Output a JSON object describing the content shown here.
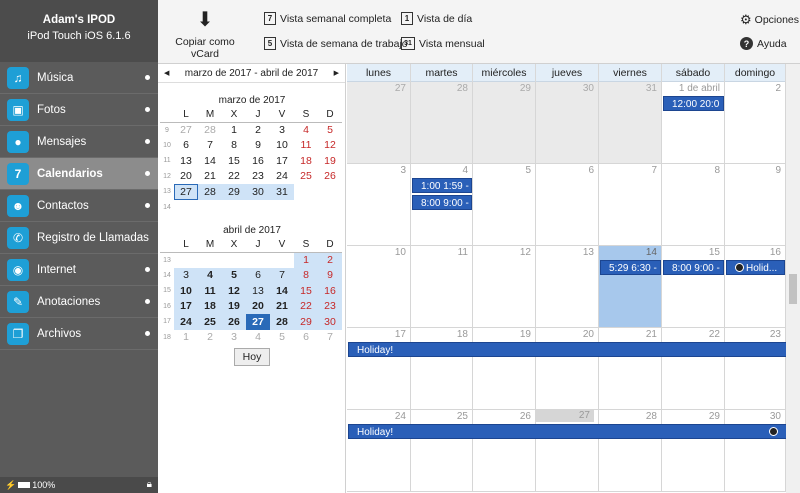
{
  "device": {
    "name": "Adam's IPOD",
    "model": "iPod Touch iOS 6.1.6"
  },
  "sidebar": {
    "items": [
      {
        "label": "Música",
        "icon": "music-icon"
      },
      {
        "label": "Fotos",
        "icon": "photos-icon"
      },
      {
        "label": "Mensajes",
        "icon": "messages-icon"
      },
      {
        "label": "Calendarios",
        "icon": "calendar-icon"
      },
      {
        "label": "Contactos",
        "icon": "contacts-icon"
      },
      {
        "label": "Registro de Llamadas",
        "icon": "phone-icon"
      },
      {
        "label": "Internet",
        "icon": "internet-icon"
      },
      {
        "label": "Anotaciones",
        "icon": "notes-icon"
      },
      {
        "label": "Archivos",
        "icon": "files-icon"
      }
    ],
    "battery": "100%"
  },
  "toolbar": {
    "vcard": "Copiar como vCard",
    "week_full": "Vista semanal completa",
    "work_week": "Vista de semana de trabajo",
    "day": "Vista de día",
    "month": "Vista mensual",
    "options": "Opciones",
    "help": "Ayuda"
  },
  "mini": {
    "range": "marzo de 2017 - abril de 2017",
    "prev": "◀",
    "next": "▶",
    "headers": [
      "L",
      "M",
      "X",
      "J",
      "V",
      "S",
      "D"
    ],
    "m1": {
      "title": "marzo de 2017",
      "weeks": [
        [
          "9",
          [
            "27",
            "28",
            "1",
            "2",
            "3",
            "4",
            "5"
          ]
        ],
        [
          "10",
          [
            "6",
            "7",
            "8",
            "9",
            "10",
            "11",
            "12"
          ]
        ],
        [
          "11",
          [
            "13",
            "14",
            "15",
            "16",
            "17",
            "18",
            "19"
          ]
        ],
        [
          "12",
          [
            "20",
            "21",
            "22",
            "23",
            "24",
            "25",
            "26"
          ]
        ],
        [
          "13",
          [
            "27",
            "28",
            "29",
            "30",
            "31",
            "",
            ""
          ]
        ],
        [
          "14",
          [
            "",
            "",
            "",
            "",
            "",
            "",
            ""
          ]
        ]
      ]
    },
    "m2": {
      "title": "abril de 2017",
      "weeks": [
        [
          "13",
          [
            "",
            "",
            "",
            "",
            "",
            "1",
            "2"
          ]
        ],
        [
          "14",
          [
            "3",
            "4",
            "5",
            "6",
            "7",
            "8",
            "9"
          ]
        ],
        [
          "15",
          [
            "10",
            "11",
            "12",
            "13",
            "14",
            "15",
            "16"
          ]
        ],
        [
          "16",
          [
            "17",
            "18",
            "19",
            "20",
            "21",
            "22",
            "23"
          ]
        ],
        [
          "17",
          [
            "24",
            "25",
            "26",
            "27",
            "28",
            "29",
            "30"
          ]
        ],
        [
          "18",
          [
            "1",
            "2",
            "3",
            "4",
            "5",
            "6",
            "7"
          ]
        ]
      ]
    },
    "today_btn": "Hoy"
  },
  "calendar": {
    "days": [
      "lunes",
      "martes",
      "miércoles",
      "jueves",
      "viernes",
      "sábado",
      "domingo"
    ],
    "weeks": [
      [
        "27",
        "28",
        "29",
        "30",
        "31",
        "1 de abril",
        "2"
      ],
      [
        "3",
        "4",
        "5",
        "6",
        "7",
        "8",
        "9"
      ],
      [
        "10",
        "11",
        "12",
        "13",
        "14",
        "15",
        "16"
      ],
      [
        "17",
        "18",
        "19",
        "20",
        "21",
        "22",
        "23"
      ],
      [
        "24",
        "25",
        "26",
        "27",
        "28",
        "29",
        "30"
      ]
    ],
    "events": [
      "12:00  20:0",
      "1:00  1:59 -",
      "8:00  9:00 -",
      "5:29  6:30 -",
      "8:00  9:00 -",
      "Holid...",
      "Holiday!",
      "Holiday!"
    ]
  }
}
